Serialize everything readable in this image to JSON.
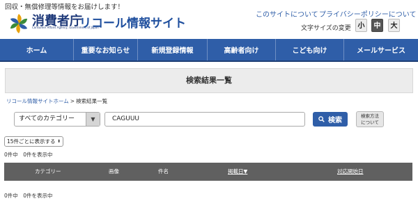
{
  "header": {
    "tagline": "回収・無償修理等情報をお届けします！",
    "logo_agency": "消費者庁",
    "logo_sub": "Consumer Affairs Agency, Government of Japan",
    "site_title": "リコール情報サイト",
    "links": {
      "about": "このサイトについて",
      "privacy": "プライバシーポリシーについて"
    },
    "font_size": {
      "label": "文字サイズの変更",
      "small": "小",
      "medium": "中",
      "large": "大",
      "selected": "中"
    }
  },
  "nav": {
    "items": [
      "ホーム",
      "重要なお知らせ",
      "新規登録情報",
      "高齢者向け",
      "こども向け",
      "メールサービス"
    ]
  },
  "page": {
    "heading": "検索結果一覧",
    "breadcrumb": {
      "home": "リコール情報サイトホーム",
      "separator": ">",
      "current": "検索結果一覧"
    }
  },
  "search": {
    "category_value": "すべてのカテゴリー",
    "query_value": "CAGUUU",
    "button_label": "検索",
    "method_line1": "検索方法",
    "method_line2": "について"
  },
  "results": {
    "per_page_value": "15件ごとに表示する",
    "count_text": "0件中　0件を表示中",
    "columns": {
      "category": "カテゴリー",
      "image": "画像",
      "name": "件名",
      "posted_date": "掲載日▼",
      "start_date": "対応開始日"
    }
  },
  "colors": {
    "brand_blue": "#2f5ea8",
    "table_header": "#606060"
  }
}
